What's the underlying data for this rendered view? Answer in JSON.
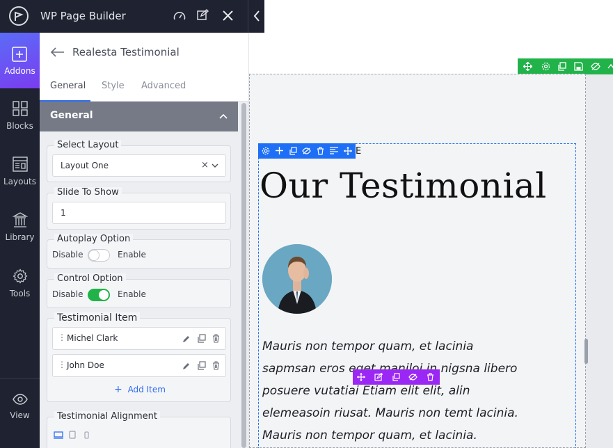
{
  "app": {
    "title": "WP Page Builder"
  },
  "rail": {
    "items": [
      {
        "label": "Addons",
        "icon": "plus-square-icon",
        "active": true
      },
      {
        "label": "Blocks",
        "icon": "blocks-icon"
      },
      {
        "label": "Layouts",
        "icon": "layouts-icon"
      },
      {
        "label": "Library",
        "icon": "library-icon"
      },
      {
        "label": "Tools",
        "icon": "gear-icon"
      },
      {
        "label": "View",
        "icon": "eye-icon"
      }
    ]
  },
  "panel": {
    "title": "Realesta Testimonial",
    "tabs": [
      "General",
      "Style",
      "Advanced"
    ],
    "active_tab": "General",
    "section_title": "General",
    "select_layout": {
      "label": "Select Layout",
      "value": "Layout One"
    },
    "slide_to_show": {
      "label": "Slide To Show",
      "value": "1"
    },
    "autoplay": {
      "label": "Autoplay Option",
      "off": "Disable",
      "on": "Enable",
      "enabled": false
    },
    "control": {
      "label": "Control Option",
      "off": "Disable",
      "on": "Enable",
      "enabled": true
    },
    "testimonial_items": {
      "label": "Testimonial Item",
      "items": [
        "Michel Clark",
        "John Doe"
      ],
      "add_label": "Add Item"
    },
    "alignment": {
      "label": "Testimonial Alignment"
    }
  },
  "canvas": {
    "subtitle_fragment": "E",
    "heading": "Our Testimonial",
    "quote": "Mauris non tempor quam, et lacinia sapmsan eros eget maniloi in nigsna libero posuere vutatiai Etiam elit elit, alin elemeasoin riusat. Mauris non temt lacinia. Mauris non tempor quam, et lacinia."
  },
  "colors": {
    "rail_bg": "#1f2230",
    "active_tab": "#2f6df2",
    "section_header": "#757a86",
    "toggle_on": "#21b34a",
    "toolbar_blue": "#1e6ff5",
    "toolbar_purple": "#9b27f5",
    "toolbar_green": "#21b34a"
  }
}
